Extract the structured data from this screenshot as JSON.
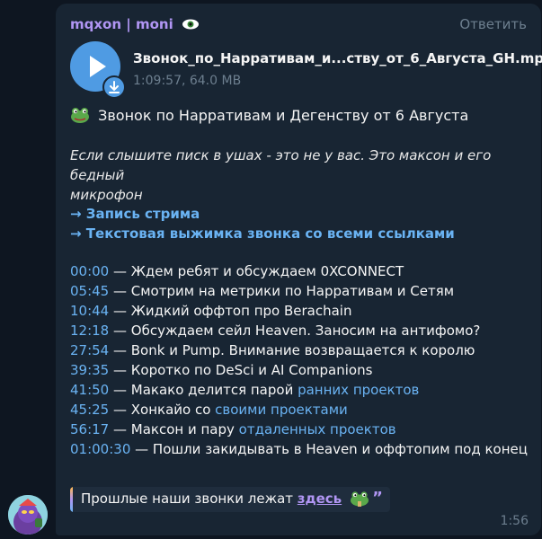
{
  "message": {
    "author": "mqxon | moni",
    "reply_label": "Ответить",
    "time": "1:56"
  },
  "file": {
    "name": "Звонок_по_Нарративам_и...ству_от_6_Августа_GH.mp3",
    "meta": "1:09:57, 64.0 MB"
  },
  "post": {
    "title": "Звонок по Нарративам и Дегенству от 6 Августа",
    "note_line1": "Если слышите писк в ушах - это не у вас. Это максон и его бедный",
    "note_line2": "микрофон",
    "link_stream": "→ Запись стрима",
    "link_summary": "→ Текстовая выжимка звонка со всеми ссылками"
  },
  "timeline": [
    {
      "time": "00:00",
      "text": " — Ждем ребят и обсуждаем 0XCONNECT",
      "link": ""
    },
    {
      "time": "05:45",
      "text": " — Смотрим на метрики по Нарративам и Сетям",
      "link": ""
    },
    {
      "time": "10:44",
      "text": " — Жидкий оффтоп про Berachain",
      "link": ""
    },
    {
      "time": "12:18",
      "text": " — Обсуждаем сейл Heaven. Заносим на антифомо?",
      "link": ""
    },
    {
      "time": "27:54",
      "text": " — Bonk и Pump. Внимание возвращается к королю",
      "link": ""
    },
    {
      "time": "39:35",
      "text": " — Коротко по DeSci и AI Companions",
      "link": ""
    },
    {
      "time": "41:50",
      "text": " — Макако делится парой ",
      "link": "ранних проектов"
    },
    {
      "time": "45:25",
      "text": " — Хонкайо со ",
      "link": "своими проектами"
    },
    {
      "time": "56:17",
      "text": " — Максон и пару ",
      "link": "отдаленных проектов"
    },
    {
      "time": "01:00:30",
      "text": " — Пошли закидывать в Heaven и оффтопим под конец",
      "link": ""
    }
  ],
  "quote": {
    "text": "Прошлые наши звонки лежат ",
    "link": "здесь",
    "mark": "”"
  },
  "colors": {
    "background": "#0e1621",
    "bubble": "#182533",
    "accent_name": "#b196f4",
    "link": "#6ab3f3",
    "play_button": "#4f9be3"
  },
  "icons": [
    "eye-icon",
    "play-icon",
    "download-icon",
    "frog-emoji-icon",
    "quote-mark-icon",
    "avatar"
  ]
}
